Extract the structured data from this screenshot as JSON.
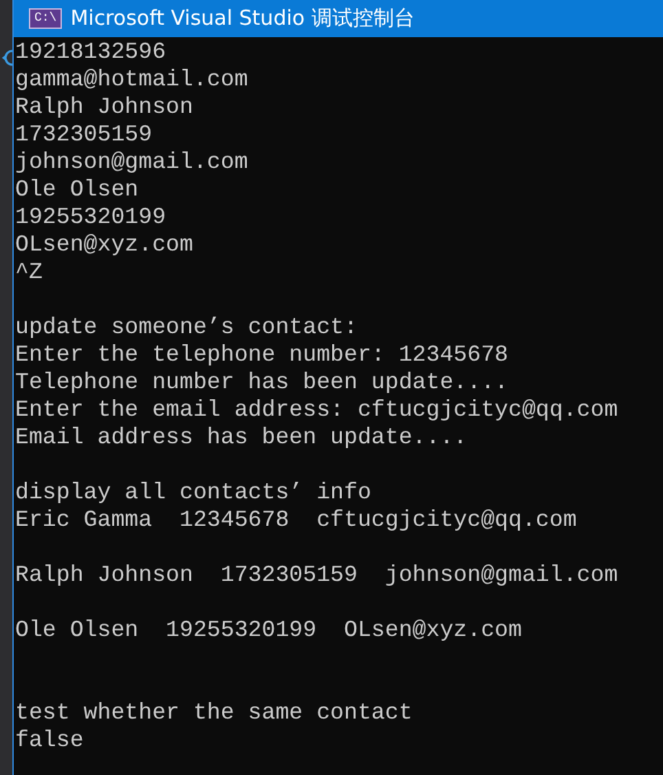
{
  "window": {
    "icon_label": "C:\\",
    "title": "Microsoft Visual Studio 调试控制台"
  },
  "console": {
    "lines": [
      {
        "kind": "text",
        "text": "19218132596"
      },
      {
        "kind": "text",
        "text": "gamma@hotmail.com"
      },
      {
        "kind": "text",
        "text": "Ralph Johnson"
      },
      {
        "kind": "text",
        "text": "1732305159"
      },
      {
        "kind": "text",
        "text": "johnson@gmail.com"
      },
      {
        "kind": "text",
        "text": "Ole Olsen"
      },
      {
        "kind": "text",
        "text": "19255320199"
      },
      {
        "kind": "text",
        "text": "OLsen@xyz.com"
      },
      {
        "kind": "text",
        "text": "^Z"
      },
      {
        "kind": "blank"
      },
      {
        "kind": "text",
        "text": "update someone’s contact:"
      },
      {
        "kind": "text",
        "text": "Enter the telephone number: 12345678"
      },
      {
        "kind": "text",
        "text": "Telephone number has been update...."
      },
      {
        "kind": "text",
        "text": "Enter the email address: cftucgjcityc@qq.com"
      },
      {
        "kind": "text",
        "text": "Email address has been update...."
      },
      {
        "kind": "blank"
      },
      {
        "kind": "text",
        "text": "display all contacts’ info"
      },
      {
        "kind": "text",
        "text": "Eric Gamma  12345678  cftucgjcityc@qq.com"
      },
      {
        "kind": "blank"
      },
      {
        "kind": "text",
        "text": "Ralph Johnson  1732305159  johnson@gmail.com"
      },
      {
        "kind": "blank"
      },
      {
        "kind": "text",
        "text": "Ole Olsen  19255320199  OLsen@xyz.com"
      },
      {
        "kind": "blank"
      },
      {
        "kind": "blank"
      },
      {
        "kind": "text",
        "text": "test whether the same contact"
      },
      {
        "kind": "text",
        "text": "false"
      }
    ]
  }
}
